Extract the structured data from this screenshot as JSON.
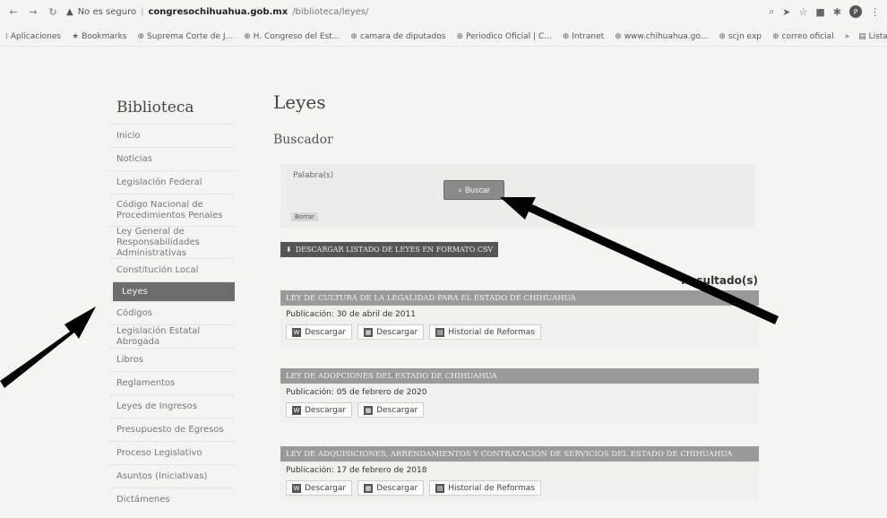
{
  "browser": {
    "security_label": "No es seguro",
    "url_host": "congresochihuahua.gob.mx",
    "url_path": "/biblioteca/leyes/",
    "avatar_letter": "P"
  },
  "bookmarks": {
    "items": [
      {
        "icon": "apps-icon",
        "label": "Aplicaciones"
      },
      {
        "icon": "star-icon",
        "label": "Bookmarks"
      },
      {
        "icon": "globe-icon",
        "label": "Suprema Corte de J..."
      },
      {
        "icon": "globe-icon",
        "label": "H. Congreso del Est..."
      },
      {
        "icon": "globe-icon",
        "label": "camara de diputados"
      },
      {
        "icon": "globe-icon",
        "label": "Periodico Oficial | C..."
      },
      {
        "icon": "globe-icon",
        "label": "Intranet"
      },
      {
        "icon": "globe-icon",
        "label": "www.chihuahua.go..."
      },
      {
        "icon": "globe-icon",
        "label": "scjn exp"
      },
      {
        "icon": "globe-icon",
        "label": "correo oficial"
      }
    ],
    "more": "»",
    "reading_list": "Lista de lectura"
  },
  "sidebar": {
    "title": "Biblioteca",
    "items": [
      {
        "label": "Inicio"
      },
      {
        "label": "Noticias"
      },
      {
        "label": "Legislación Federal"
      },
      {
        "label": "Código Nacional de Procedimientos Penales"
      },
      {
        "label": "Ley General de Responsabilidades Administrativas"
      },
      {
        "label": "Constitución Local"
      },
      {
        "label": "Leyes"
      },
      {
        "label": "Códigos"
      },
      {
        "label": "Legislación Estatal Abrogada"
      },
      {
        "label": "Libros"
      },
      {
        "label": "Reglamentos"
      },
      {
        "label": "Leyes de Ingresos"
      },
      {
        "label": "Presupuesto de Egresos"
      },
      {
        "label": "Proceso Legislativo"
      },
      {
        "label": "Asuntos (Iniciativas)"
      },
      {
        "label": "Dictámenes"
      }
    ],
    "active_index": 6
  },
  "main": {
    "title": "Leyes",
    "search_title": "Buscador",
    "search_label": "Palabra(s)",
    "search_placeholder": "",
    "search_button": "Buscar",
    "clear_label": "Borrar",
    "csv_button": "DESCARGAR LISTADO DE LEYES EN FORMATO CSV",
    "results": "Resultado(s)",
    "laws": [
      {
        "title": "LEY DE CULTURA DE LA LEGALIDAD PARA EL ESTADO DE CHIHUAHUA",
        "date": "Publicación: 30 de abril de 2011",
        "actions": [
          "Descargar",
          "Descargar",
          "Historial de Reformas"
        ]
      },
      {
        "title": "LEY DE ADOPCIONES DEL ESTADO DE CHIHUAHUA",
        "date": "Publicación: 05 de febrero de 2020",
        "actions": [
          "Descargar",
          "Descargar"
        ]
      },
      {
        "title": "LEY DE ADQUISICIONES, ARRENDAMIENTOS Y CONTRATACIÓN DE SERVICIOS DEL ESTADO DE CHIHUAHUA",
        "date": "Publicación: 17 de febrero de 2018",
        "actions": [
          "Descargar",
          "Descargar",
          "Historial de Reformas"
        ]
      }
    ]
  }
}
